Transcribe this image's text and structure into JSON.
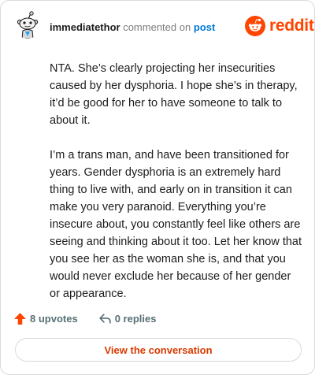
{
  "header": {
    "username": "immediatethor",
    "action": "commented on",
    "post_link": "post",
    "brand": "reddit"
  },
  "comment": {
    "paragraphs": [
      "NTA. She’s clearly projecting her insecurities caused by her dysphoria. I hope she’s in therapy, it’d be good for her to have someone to talk to about it.",
      "I’m a trans man, and have been transitioned for years. Gender dysphoria is an extremely hard thing to live with, and early on in transition it can make you very paranoid. Everything you’re insecure about, you constantly feel like others are seeing and thinking about it too. Let her know that you see her as the woman she is, and that you would never exclude her because of her gender or appearance."
    ]
  },
  "footer": {
    "upvotes": "8 upvotes",
    "replies": "0 replies"
  },
  "cta": {
    "label": "View the conversation"
  },
  "colors": {
    "brand": "#ff4500",
    "link": "#0079d3",
    "cta_text": "#d93a00",
    "muted": "#576f76"
  },
  "icons": {
    "upvote": "arrow-up-icon",
    "reply": "reply-arrow-icon",
    "logo": "reddit-snoo-icon"
  }
}
